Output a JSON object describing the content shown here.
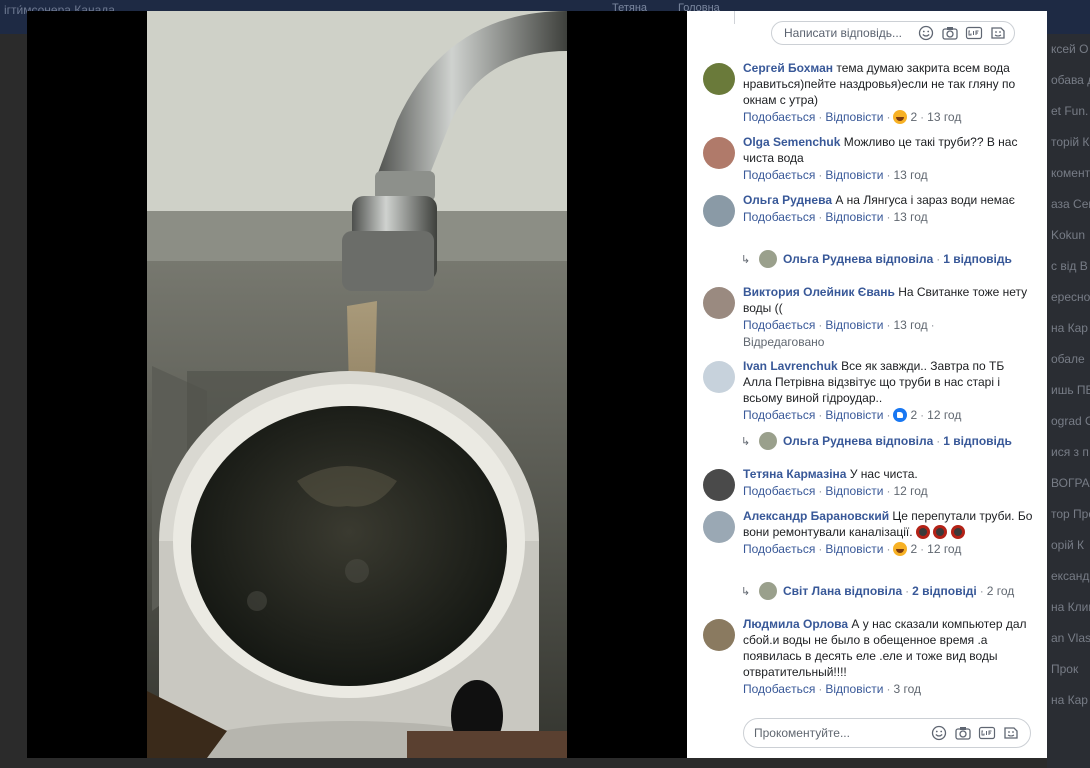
{
  "background": {
    "topbar_text": "ігти́мсонера Канада",
    "topbar_chip1": "Тетяна",
    "topbar_chip2": "Головна",
    "right_snippets": [
      "ксей О",
      "обава д",
      "et Fun.",
      "торій К",
      "коментарі",
      "аза Сенч",
      "Kokun",
      "с від В",
      "ересно",
      "на Кар",
      "обале",
      "ишь ПЕР",
      "ograd O",
      "ися з п",
      "ВОГРАД",
      "тор Про",
      "орій К",
      "ександ",
      "на Клим",
      "an Vlas",
      "Прок",
      "на Кар"
    ]
  },
  "reply_box": {
    "placeholder": "Написати відповідь..."
  },
  "comment_box": {
    "placeholder": "Прокоментуйте..."
  },
  "actions": {
    "like": "Подобається",
    "reply": "Відповісти"
  },
  "comments": [
    {
      "name": "Сергей Бохман",
      "text": "тема думаю закрита всем вода нравиться)пейте наздровья)если не так гляну по окнам с утра)",
      "reaction": "haha",
      "reaction_count": "2",
      "time": "13 год",
      "avatar_color": "#6a7a3a"
    },
    {
      "name": "Olga Semenchuk",
      "text": "Можливо це такі труби?? В нас чиста вода",
      "time": "13 год",
      "avatar_color": "#b07a6a"
    },
    {
      "name": "Ольга Руднева",
      "text": "А на Лянгуса і зараз води немає",
      "time": "13 год",
      "avatar_color": "#8a9aa6"
    },
    {
      "name": "Виктория Олейник Євань",
      "text": "На Свитанке тоже нету воды ((",
      "time": "13 год",
      "edited": "Відредаговано",
      "avatar_color": "#9a8a80"
    },
    {
      "name": "Ivan Lavrenchuk",
      "text": "Все як завжди.. Завтра по ТБ Алла Петрівна відзвітує що труби в нас старі і всьому виной гідроудар..",
      "reaction": "like",
      "reaction_count": "2",
      "time": "12 год",
      "avatar_color": "#c7d2dc"
    },
    {
      "name": "Тетяна Кармазіна",
      "text": "У нас чиста.",
      "time": "12 год",
      "avatar_color": "#4a4a4a"
    },
    {
      "name": "Александр Барановский",
      "text": "Це перепутали труби. Бо вони ремонтували каналізації.",
      "reaction": "haha",
      "reaction_count": "2",
      "time": "12 год",
      "avatar_color": "#9aa8b4"
    },
    {
      "name": "Людмила Орлова",
      "text": "А у нас сказали компьютер дал сбой.и воды не было в обещенное время .а появилась в десять еле .еле и тоже вид воды отвратительный!!!!",
      "time": "3 год",
      "avatar_color": "#8a7a60"
    }
  ],
  "replies": [
    {
      "who": "Ольга Руднева відповіла",
      "count": "1 відповідь"
    },
    {
      "who": "Ольга Руднева відповіла",
      "count": "1 відповідь"
    },
    {
      "who": "Світ Лана відповіла",
      "count": "2 відповіді",
      "time": "2 год"
    }
  ]
}
